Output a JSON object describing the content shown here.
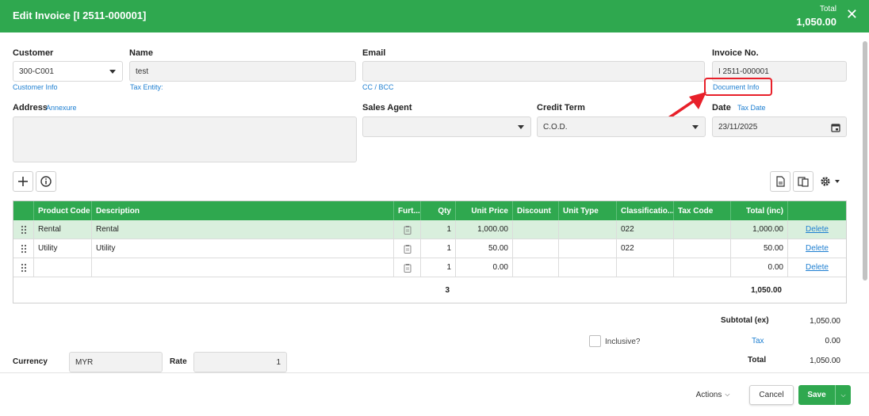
{
  "header": {
    "title": "Edit Invoice [I 2511-000001]",
    "total_label": "Total",
    "total_value": "1,050.00"
  },
  "customer": {
    "label": "Customer",
    "value": "300-C001",
    "link": "Customer Info"
  },
  "name": {
    "label": "Name",
    "value": "test",
    "link": "Tax Entity:"
  },
  "email": {
    "label": "Email",
    "value": "",
    "link": "CC / BCC"
  },
  "invoice_no": {
    "label": "Invoice No.",
    "value": "I 2511-000001",
    "link": "Document Info"
  },
  "address": {
    "label": "Address",
    "link": "Annexure",
    "value": ""
  },
  "sales_agent": {
    "label": "Sales Agent",
    "value": ""
  },
  "credit_term": {
    "label": "Credit Term",
    "value": "C.O.D."
  },
  "date": {
    "label": "Date",
    "link": "Tax Date",
    "value": "23/11/2025"
  },
  "table": {
    "columns": [
      "",
      "Product Code",
      "Description",
      "Furt...",
      "Qty",
      "Unit Price",
      "Discount",
      "Unit Type",
      "Classificatio...",
      "Tax Code",
      "Total (inc)",
      ""
    ],
    "rows": [
      {
        "code": "Rental",
        "desc": "Rental",
        "qty": "1",
        "price": "1,000.00",
        "discount": "",
        "unit": "",
        "class": "022",
        "tax": "",
        "total": "1,000.00",
        "action": "Delete"
      },
      {
        "code": "Utility",
        "desc": "Utility",
        "qty": "1",
        "price": "50.00",
        "discount": "",
        "unit": "",
        "class": "022",
        "tax": "",
        "total": "50.00",
        "action": "Delete"
      },
      {
        "code": "",
        "desc": "",
        "qty": "1",
        "price": "0.00",
        "discount": "",
        "unit": "",
        "class": "",
        "tax": "",
        "total": "0.00",
        "action": "Delete"
      }
    ],
    "total_qty": "3",
    "grand_total": "1,050.00"
  },
  "summary": {
    "subtotal_label": "Subtotal (ex)",
    "subtotal_value": "1,050.00",
    "inclusive_label": "Inclusive?",
    "tax_label": "Tax",
    "tax_value": "0.00",
    "total_label": "Total",
    "total_value": "1,050.00"
  },
  "currency": {
    "label": "Currency",
    "value": "MYR",
    "rate_label": "Rate",
    "rate_value": "1"
  },
  "footer": {
    "actions": "Actions",
    "cancel": "Cancel",
    "save": "Save"
  },
  "colors": {
    "primary": "#2fa84f",
    "link": "#1e7fd1",
    "highlight_row": "#d9efdd",
    "annotation": "#e8202a"
  },
  "icons": [
    "close-icon",
    "plus-icon",
    "info-icon",
    "drag-handle-icon",
    "clipboard-icon",
    "calendar-icon",
    "document-icon",
    "copy-icon",
    "gear-icon",
    "chevron-down-icon",
    "red-arrow-annotation"
  ]
}
